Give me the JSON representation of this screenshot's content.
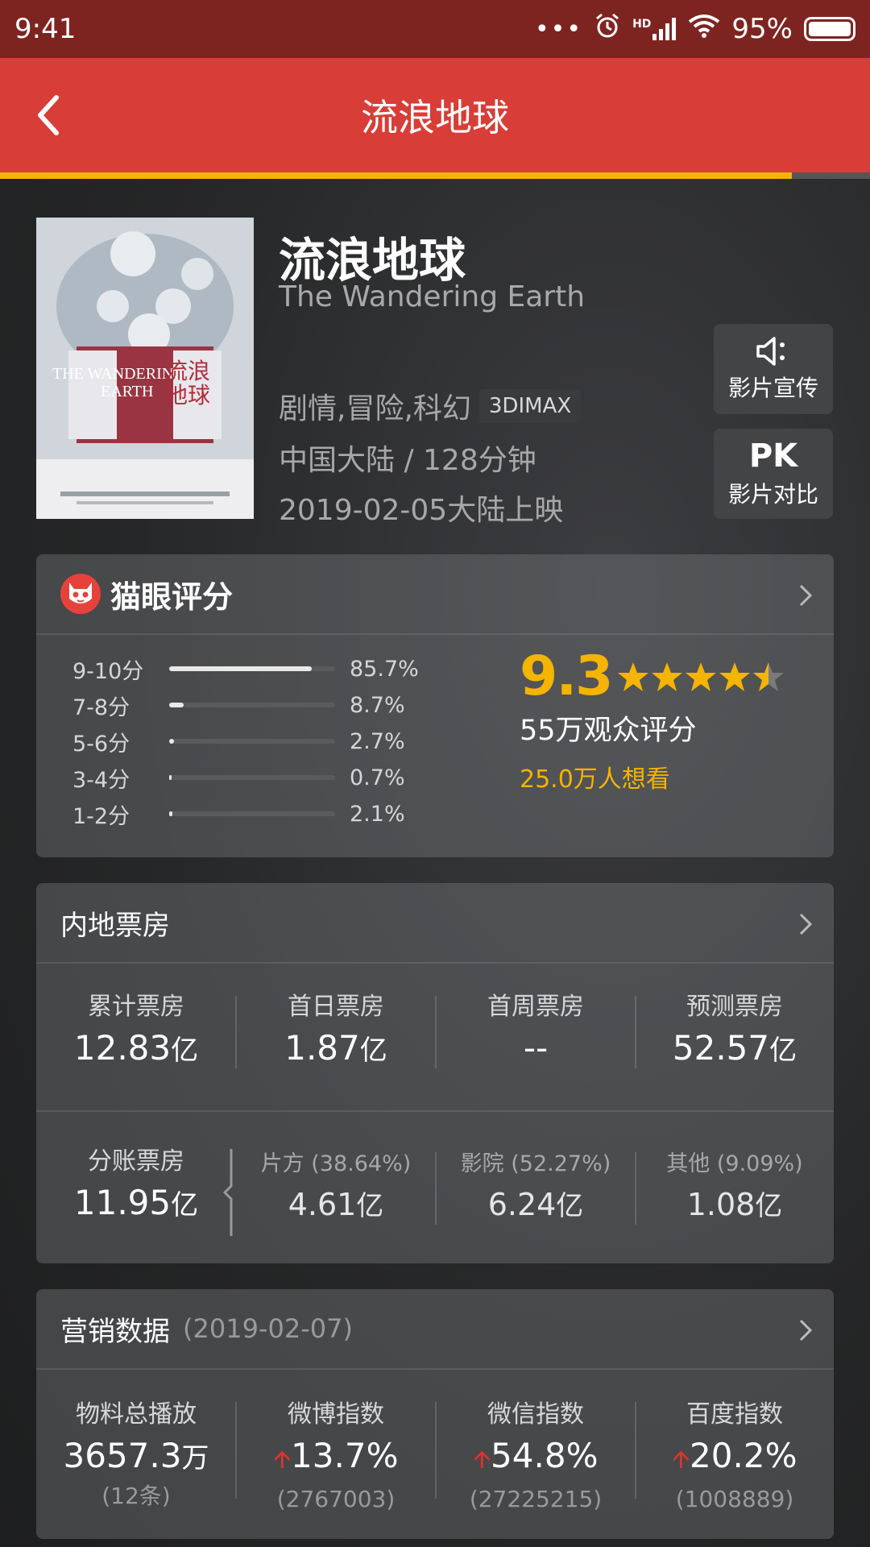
{
  "status_bar": {
    "time": "9:41",
    "signal": "HD",
    "battery": "95%"
  },
  "header": {
    "title": "流浪地球"
  },
  "colors": {
    "header": "#d83d37",
    "status_bar": "#7e2420",
    "accent": "#f5b400",
    "up_arrow": "#e0332c"
  },
  "movie": {
    "title": "流浪地球",
    "title_en": "The Wandering Earth",
    "genres": "剧情,冒险,科幻",
    "format_tag": "3DIMAX",
    "region_duration": "中国大陆 / 128分钟",
    "release": "2019-02-05大陆上映",
    "promo_button": "影片宣传",
    "pk_button_top": "PK",
    "pk_button": "影片对比"
  },
  "rating": {
    "title": "猫眼评分",
    "score": "9.3",
    "stars": 4.5,
    "count": "55万观众评分",
    "want": "25.0万人想看",
    "distribution": [
      {
        "label": "9-10分",
        "pct": "85.7%",
        "value": 0.857
      },
      {
        "label": "7-8分",
        "pct": "8.7%",
        "value": 0.087
      },
      {
        "label": "5-6分",
        "pct": "2.7%",
        "value": 0.027
      },
      {
        "label": "3-4分",
        "pct": "0.7%",
        "value": 0.007
      },
      {
        "label": "1-2分",
        "pct": "2.1%",
        "value": 0.021
      }
    ]
  },
  "box_office": {
    "title": "内地票房",
    "stats": [
      {
        "label": "累计票房",
        "value": "12.83",
        "unit": "亿"
      },
      {
        "label": "首日票房",
        "value": "1.87",
        "unit": "亿"
      },
      {
        "label": "首周票房",
        "value": "--",
        "unit": ""
      },
      {
        "label": "预测票房",
        "value": "52.57",
        "unit": "亿"
      }
    ],
    "split_total": {
      "label": "分账票房",
      "value": "11.95",
      "unit": "亿"
    },
    "split": [
      {
        "label": "片方 (38.64%)",
        "value": "4.61",
        "unit": "亿"
      },
      {
        "label": "影院 (52.27%)",
        "value": "6.24",
        "unit": "亿"
      },
      {
        "label": "其他 (9.09%)",
        "value": "1.08",
        "unit": "亿"
      }
    ]
  },
  "marketing": {
    "title": "营销数据",
    "date": "(2019-02-07)",
    "stats": [
      {
        "label": "物料总播放",
        "value": "3657.3",
        "unit": "万",
        "sub": "(12条)",
        "up": false
      },
      {
        "label": "微博指数",
        "value": "13.7%",
        "unit": "",
        "sub": "(2767003)",
        "up": true
      },
      {
        "label": "微信指数",
        "value": "54.8%",
        "unit": "",
        "sub": "(27225215)",
        "up": true
      },
      {
        "label": "百度指数",
        "value": "20.2%",
        "unit": "",
        "sub": "(1008889)",
        "up": true
      }
    ]
  }
}
